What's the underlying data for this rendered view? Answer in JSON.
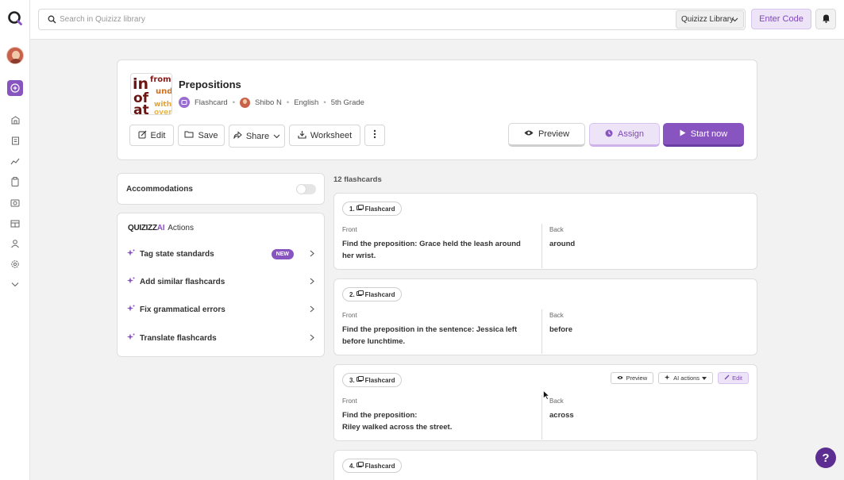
{
  "sidebar": {
    "icons": [
      "quizizz-logo-icon",
      "create-plus-icon",
      "explore-icon",
      "library-icon",
      "reports-icon",
      "classes-icon",
      "media-icon",
      "school-icon",
      "people-icon",
      "settings-icon",
      "chevron-down-icon"
    ]
  },
  "topbar": {
    "search_placeholder": "Search in Quizizz library",
    "library_select": "Quizizz Library",
    "enter_code": "Enter Code"
  },
  "quiz": {
    "title": "Prepositions",
    "type": "Flashcard",
    "author": "Shibo N",
    "language": "English",
    "grade": "5th Grade",
    "thumbnail_words": [
      "in",
      "from",
      "of",
      "und",
      "at",
      "with",
      "over"
    ]
  },
  "actions": {
    "edit": "Edit",
    "save": "Save",
    "share": "Share",
    "worksheet": "Worksheet",
    "preview": "Preview",
    "assign": "Assign",
    "start_now": "Start now"
  },
  "accommodations": {
    "label": "Accommodations",
    "enabled": false
  },
  "ai_panel": {
    "brand": "QUIZIZZ",
    "brand_ai": "AI",
    "title": "Actions",
    "new_badge": "NEW",
    "items": [
      "Tag state standards",
      "Add similar flashcards",
      "Fix grammatical errors",
      "Translate flashcards"
    ]
  },
  "flashcards": {
    "count_label": "12 flashcards",
    "front_label": "Front",
    "back_label": "Back",
    "card_actions": {
      "preview": "Preview",
      "ai_actions": "AI actions",
      "edit": "Edit"
    },
    "cards": [
      {
        "tag": "1.",
        "type": "Flashcard",
        "front": "Find the preposition: Grace held the leash around her wrist.",
        "back": "around"
      },
      {
        "tag": "2.",
        "type": "Flashcard",
        "front": "Find the preposition in the sentence: Jessica left before lunchtime.",
        "back": "before"
      },
      {
        "tag": "3.",
        "type": "Flashcard",
        "front_line1": "Find the preposition:",
        "front_line2": "Riley walked across the street.",
        "back": "across"
      },
      {
        "tag": "4.",
        "type": "Flashcard"
      }
    ]
  },
  "help": "?",
  "colors": {
    "brand": "#8854c0",
    "brand_light": "#ede4f7",
    "help": "#5d2e91"
  }
}
